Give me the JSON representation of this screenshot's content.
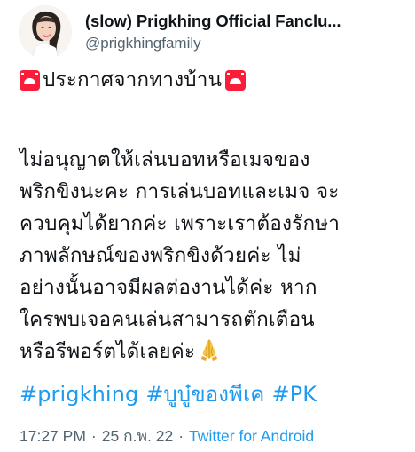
{
  "author": {
    "display_name": "(slow) Prigkhing Official Fanclu...",
    "handle": "@prigkhingfamily",
    "avatar_icon": "profile-photo"
  },
  "tweet": {
    "announcement": {
      "leading_icon": "rotating-light-icon",
      "text": "ประกาศจากทางบ้าน",
      "trailing_icon": "rotating-light-icon"
    },
    "body_lines": [
      "ไม่อนุญาตให้เล่นบอทหรือเมจของ",
      "พริกขิงนะคะ การเล่นบอทและเมจ จะ",
      "ควบคุมได้ยากค่ะ เพราะเราต้องรักษา",
      "ภาพลักษณ์ของพริกขิงด้วยค่ะ ไม่",
      "อย่างนั้นอาจมีผลต่องานได้ค่ะ หาก",
      "ใครพบเจอคนเล่นสามารถตักเตือน"
    ],
    "final_line": "หรือรีพอร์ตได้เลยค่ะ",
    "final_icon": "folded-hands-icon",
    "hashtags": [
      "#prigkhing",
      "#บูบู๋ของพีเค",
      "#PK"
    ]
  },
  "meta": {
    "time": "17:27 PM",
    "separator": "·",
    "date": "25 ก.พ. 22",
    "source": "Twitter for Android"
  },
  "colors": {
    "text": "#0f1419",
    "secondary": "#536471",
    "link": "#1d9bf0",
    "alert": "#f91d3a"
  }
}
